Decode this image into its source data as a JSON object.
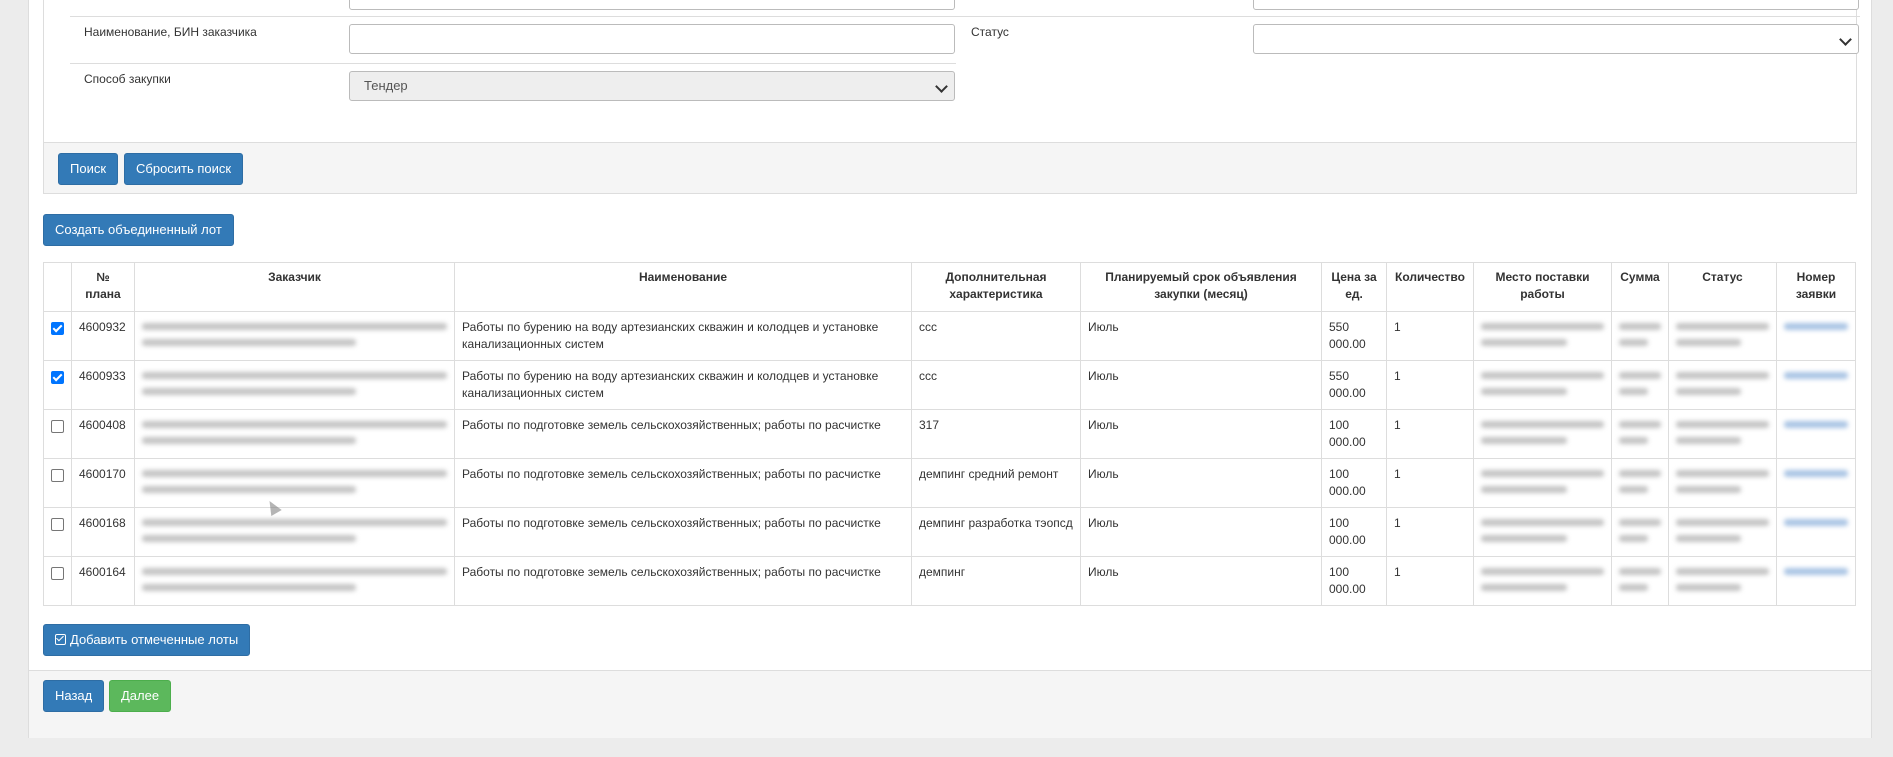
{
  "search": {
    "fields": {
      "customer_label": "Наименование, БИН заказчика",
      "customer_value": "",
      "status_label": "Статус",
      "status_value": "",
      "method_label": "Способ закупки",
      "method_value": "Тендер"
    },
    "search_button": "Поиск",
    "reset_button": "Сбросить поиск"
  },
  "create_combined_lot_button": "Создать объединенный лот",
  "table": {
    "columns": [
      "№ плана",
      "Заказчик",
      "Наименование",
      "Дополнительная характеристика",
      "Планируемый срок объявления закупки (месяц)",
      "Цена за ед.",
      "Количество",
      "Место поставки работы",
      "Сумма",
      "Статус",
      "Номер заявки"
    ],
    "rows": [
      {
        "checked": true,
        "plan": "4600932",
        "name": "Работы по бурению на воду артезианских скважин и колодцев и установке канализационных систем",
        "extra": "ссс",
        "month": "Июль",
        "price": "550 000.00",
        "qty": "1"
      },
      {
        "checked": true,
        "plan": "4600933",
        "name": "Работы по бурению на воду артезианских скважин и колодцев и установке канализационных систем",
        "extra": "ссс",
        "month": "Июль",
        "price": "550 000.00",
        "qty": "1"
      },
      {
        "checked": false,
        "plan": "4600408",
        "name": "Работы по подготовке земель сельскохозяйственных; работы по расчистке",
        "extra": "317",
        "month": "Июль",
        "price": "100 000.00",
        "qty": "1"
      },
      {
        "checked": false,
        "plan": "4600170",
        "name": "Работы по подготовке земель сельскохозяйственных; работы по расчистке",
        "extra": "демпинг средний ремонт",
        "month": "Июль",
        "price": "100 000.00",
        "qty": "1"
      },
      {
        "checked": false,
        "plan": "4600168",
        "name": "Работы по подготовке земель сельскохозяйственных; работы по расчистке",
        "extra": "демпинг разработка тэопсд",
        "month": "Июль",
        "price": "100 000.00",
        "qty": "1"
      },
      {
        "checked": false,
        "plan": "4600164",
        "name": "Работы по подготовке земель сельскохозяйственных; работы по расчистке",
        "extra": "демпинг",
        "month": "Июль",
        "price": "100 000.00",
        "qty": "1"
      }
    ]
  },
  "add_checked_lots_button": "Добавить отмеченные лоты",
  "back_button": "Назад",
  "next_button": "Далее",
  "icons": {
    "add_lots": "check-square-icon",
    "select_chevron": "chevron-down-icon"
  },
  "colors": {
    "primary": "#337ab7",
    "success": "#5cb85c",
    "checkbox_checked": "#0075ff"
  }
}
